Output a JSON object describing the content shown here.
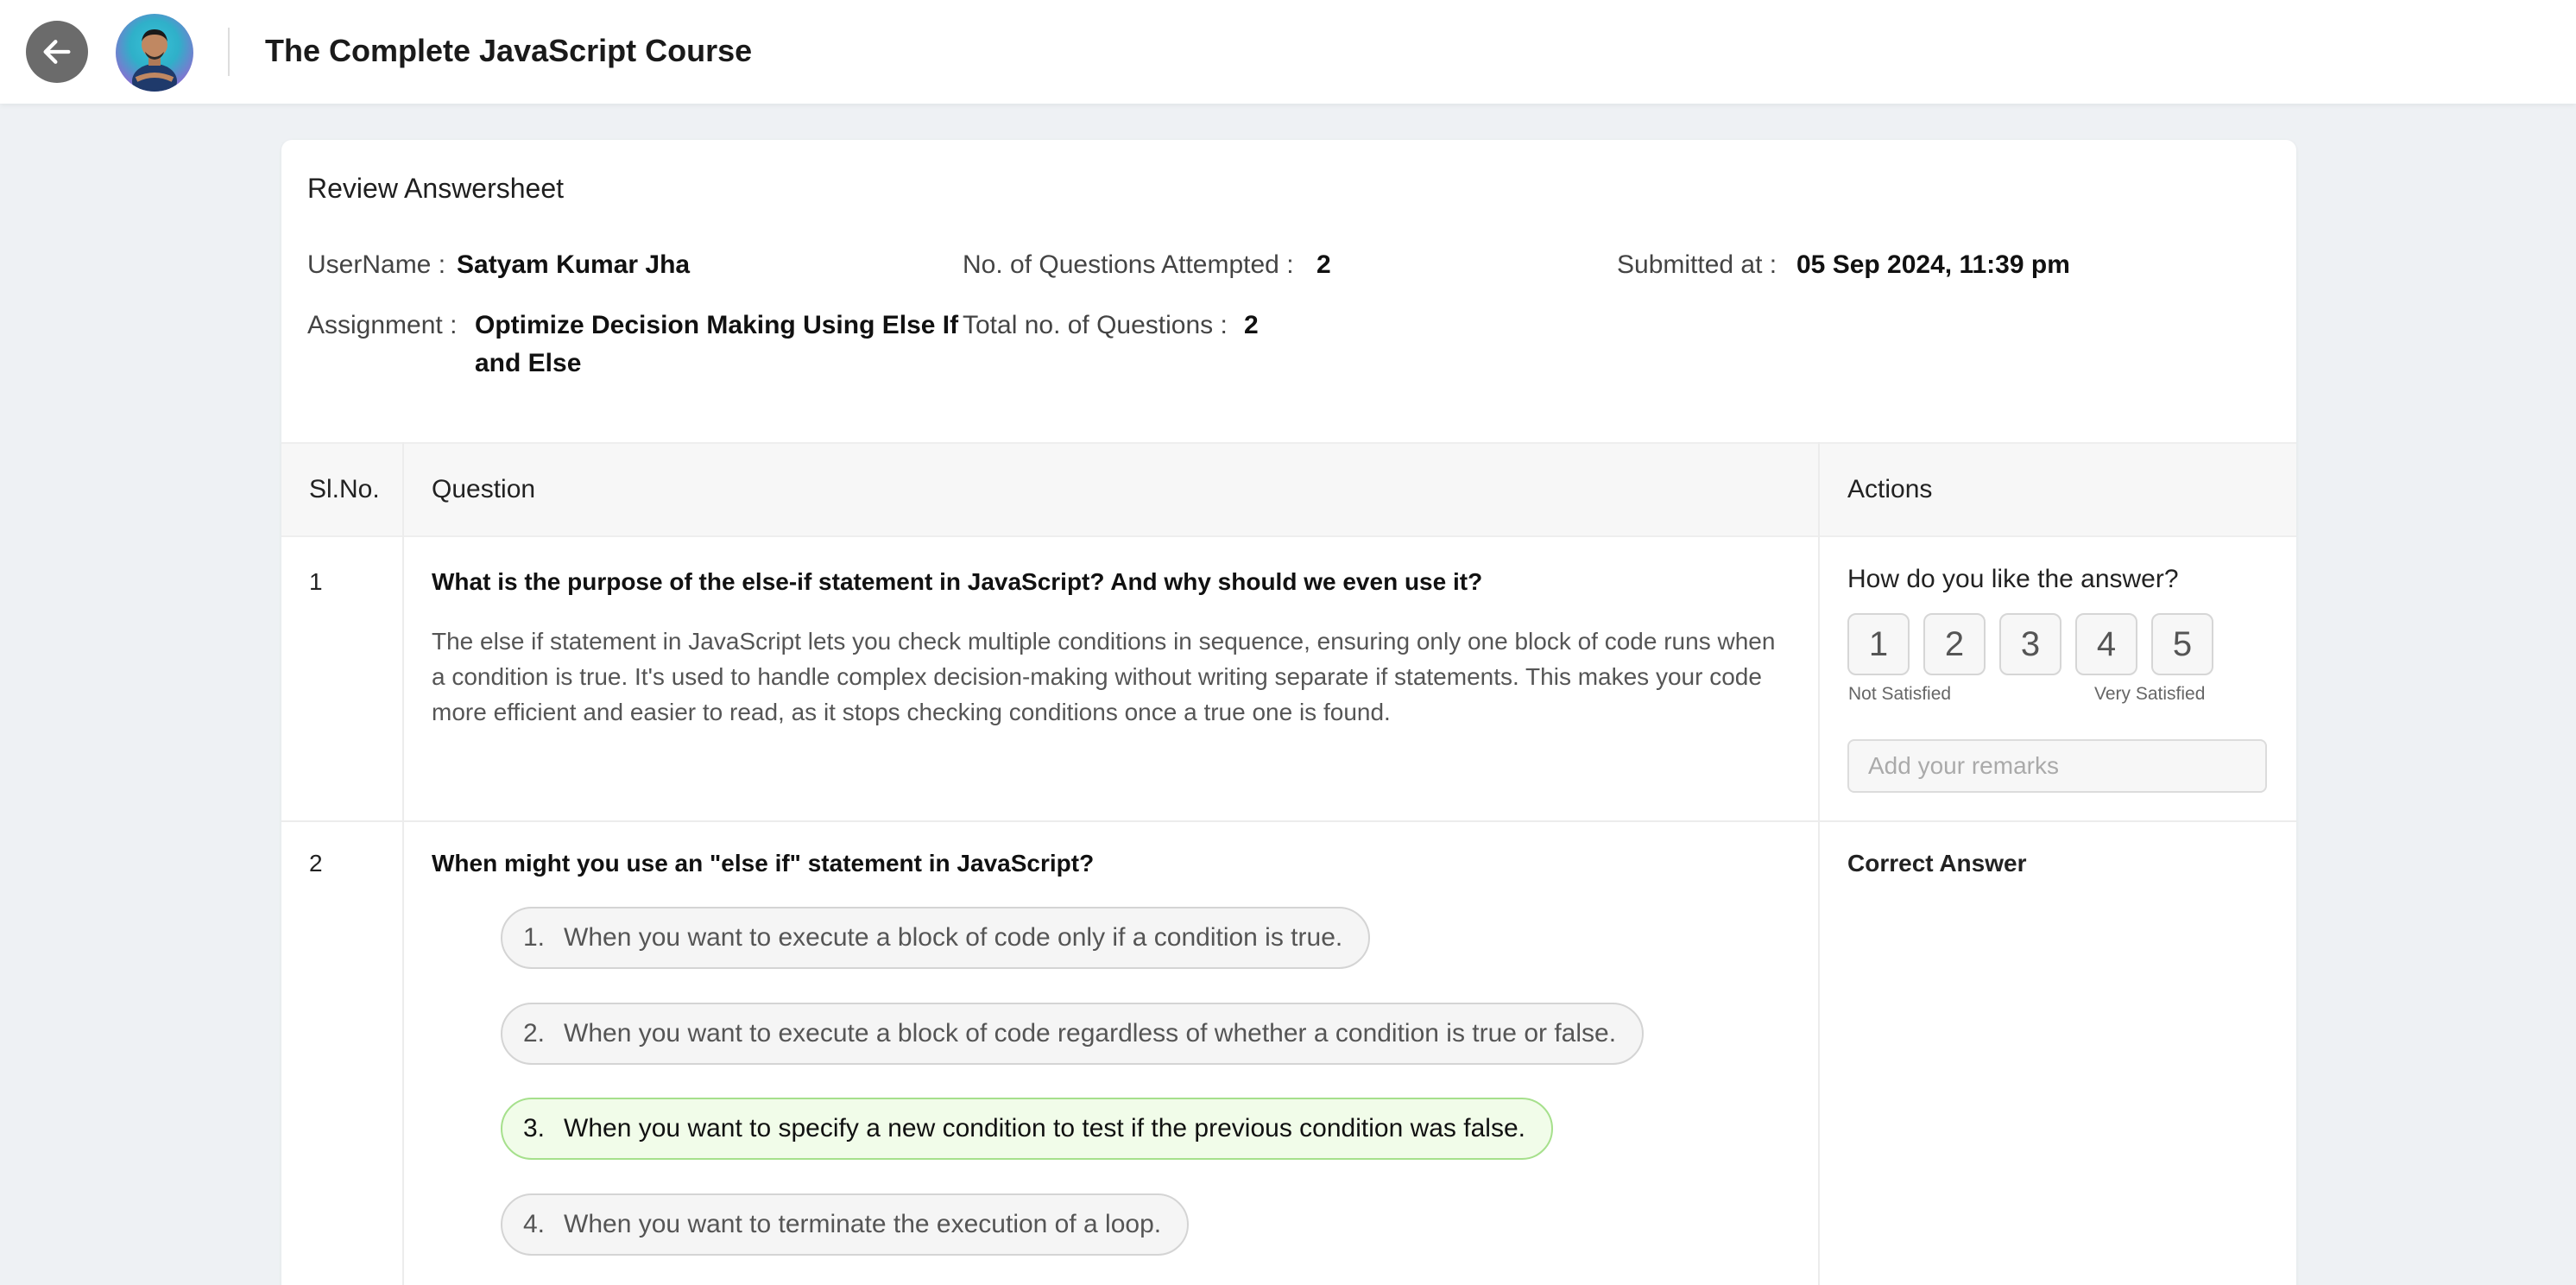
{
  "header": {
    "course_title": "The Complete JavaScript Course",
    "back_icon": "arrow-left-icon",
    "avatar": "instructor-avatar"
  },
  "review": {
    "title": "Review Answersheet",
    "meta": {
      "username_label": "UserName :",
      "username": "Satyam Kumar Jha",
      "attempted_label": "No. of Questions Attempted :",
      "attempted": "2",
      "submitted_label": "Submitted at :",
      "submitted": "05 Sep 2024, 11:39 pm",
      "assignment_label": "Assignment :",
      "assignment_line1": "Optimize Decision Making Using Else If",
      "assignment_line2": "and Else",
      "total_label": "Total no. of Questions :",
      "total": "2"
    }
  },
  "table": {
    "headers": {
      "slno": "Sl.No.",
      "question": "Question",
      "actions": "Actions"
    },
    "rows": [
      {
        "slno": "1",
        "question": "What is the purpose of the else-if statement in JavaScript? And why should we even use it?",
        "answer": "The else if statement in JavaScript lets you check multiple conditions in sequence, ensuring only one block of code runs when a condition is true. It's used to handle complex decision-making without writing separate if statements. This makes your code more efficient and easier to read, as it stops checking conditions once a true one is found.",
        "rating": {
          "title": "How do you like the answer?",
          "options": [
            "1",
            "2",
            "3",
            "4",
            "5"
          ],
          "low_label": "Not Satisfied",
          "high_label": "Very Satisfied"
        },
        "remarks_placeholder": "Add your remarks"
      },
      {
        "slno": "2",
        "question": "When might you use an \"else if\" statement in JavaScript?",
        "options": [
          {
            "num": "1.",
            "text": "When you want to execute a block of code only if a condition is true."
          },
          {
            "num": "2.",
            "text": "When you want to execute a block of code regardless of whether a condition is true or false."
          },
          {
            "num": "3.",
            "text": "When you want to specify a new condition to test if the previous condition was false."
          },
          {
            "num": "4.",
            "text": "When you want to terminate the execution of a loop."
          }
        ],
        "correct_option_index": 2,
        "action_label": "Correct Answer"
      }
    ]
  },
  "colors": {
    "page_bg": "#eef1f4",
    "correct_border": "#a6e08c",
    "correct_bg": "#f1fce9"
  }
}
